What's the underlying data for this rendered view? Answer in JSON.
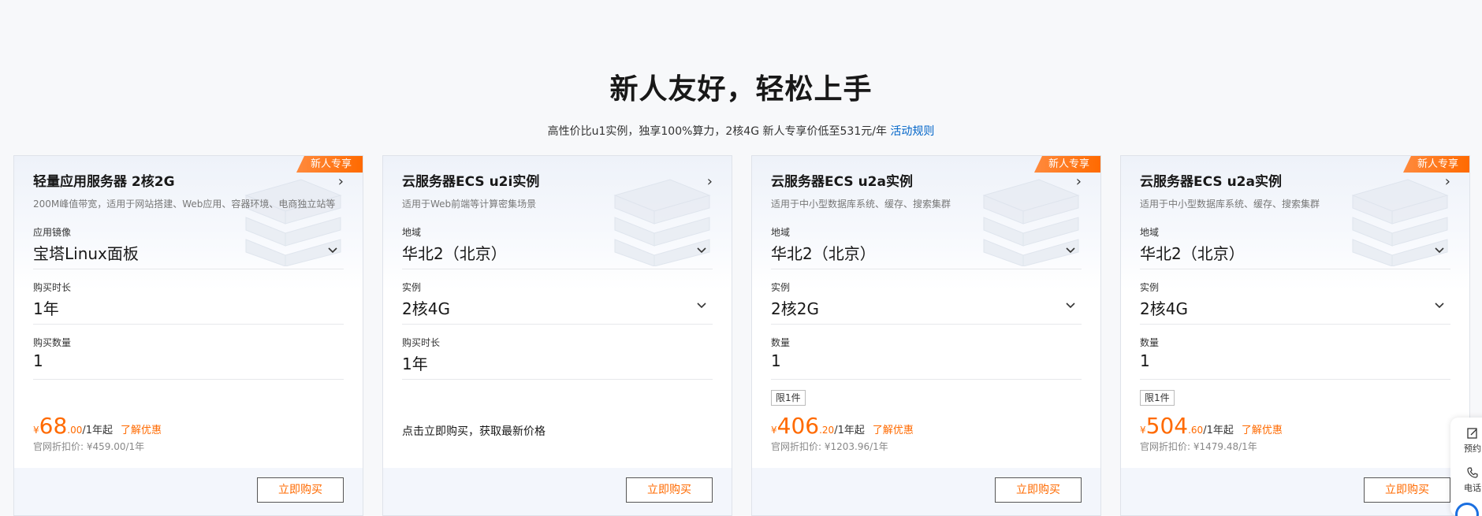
{
  "header": {
    "title": "新人友好，轻松上手",
    "subtitle": "高性价比u1实例，独享100%算力，2核4G 新人专享价低至531元/年 ",
    "subtitle_link": "活动规则"
  },
  "cards": [
    {
      "badge": "新人专享",
      "title": "轻量应用服务器 2核2G",
      "desc": "200M峰值带宽，适用于网站搭建、Web应用、容器环境、电商独立站等",
      "fields": [
        {
          "label": "应用镜像",
          "value": "宝塔Linux面板"
        },
        {
          "label": "购买时长",
          "value": "1年"
        },
        {
          "label": "购买数量",
          "value": "1"
        }
      ],
      "price": {
        "currency": "¥",
        "int": "68",
        "dec": ".00",
        "unit": "/1年起",
        "link": "了解优惠"
      },
      "orig_price": "官网折扣价: ¥459.00/1年",
      "buy": "立即购买"
    },
    {
      "title": "云服务器ECS u2i实例",
      "desc": "适用于Web前端等计算密集场景",
      "fields": [
        {
          "label": "地域",
          "value": "华北2（北京）"
        },
        {
          "label": "实例",
          "value": "2核4G"
        },
        {
          "label": "购买时长",
          "value": "1年"
        }
      ],
      "notice": "点击立即购买，获取最新价格",
      "buy": "立即购买"
    },
    {
      "badge": "新人专享",
      "title": "云服务器ECS u2a实例",
      "desc": "适用于中小型数据库系统、缓存、搜索集群",
      "fields": [
        {
          "label": "地域",
          "value": "华北2（北京）"
        },
        {
          "label": "实例",
          "value": "2核2G"
        },
        {
          "label": "数量",
          "value": "1"
        }
      ],
      "limit": "限1件",
      "price": {
        "currency": "¥",
        "int": "406",
        "dec": ".20",
        "unit": "/1年起",
        "link": "了解优惠"
      },
      "orig_price": "官网折扣价: ¥1203.96/1年",
      "buy": "立即购买"
    },
    {
      "badge": "新人专享",
      "title": "云服务器ECS u2a实例",
      "desc": "适用于中小型数据库系统、缓存、搜索集群",
      "fields": [
        {
          "label": "地域",
          "value": "华北2（北京）"
        },
        {
          "label": "实例",
          "value": "2核4G"
        },
        {
          "label": "数量",
          "value": "1"
        }
      ],
      "limit": "限1件",
      "price": {
        "currency": "¥",
        "int": "504",
        "dec": ".60",
        "unit": "/1年起",
        "link": "了解优惠"
      },
      "orig_price": "官网折扣价: ¥1479.48/1年",
      "buy": "立即购买"
    }
  ],
  "side": {
    "reserve": "预约",
    "phone": "电话"
  },
  "colors": {
    "accent": "#ff6a00",
    "link": "#0064c8"
  }
}
